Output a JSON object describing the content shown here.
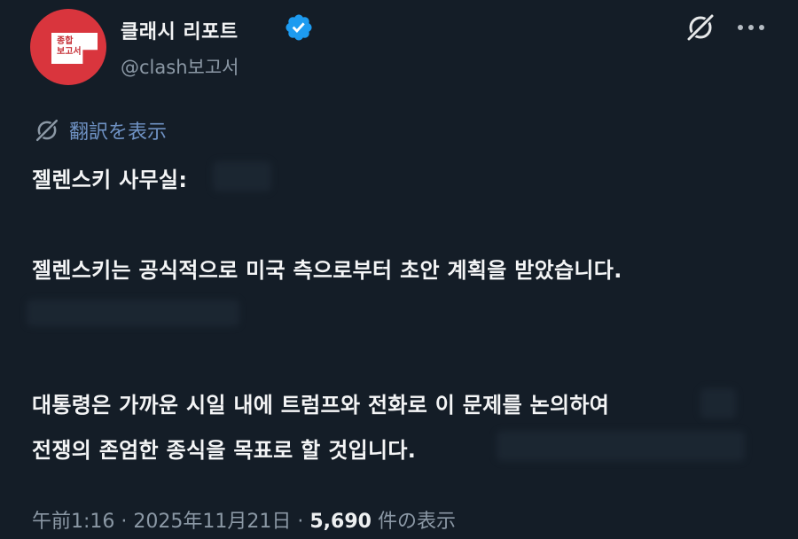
{
  "account": {
    "display_name": "클래시 리포트",
    "handle": "@clash보고서",
    "avatar_text": "종합\n보고서",
    "verified": true
  },
  "actions": {
    "grok_icon": "grok-icon",
    "more_icon": "more-dots-icon"
  },
  "translate": {
    "icon": "grok-icon",
    "label": "翻訳を表示"
  },
  "post": {
    "lines": [
      "젤렌스키 사무실:",
      "젤렌스키는 공식적으로 미국 측으로부터 초안 계획을 받았습니다.",
      "대통령은 가까운 시일 내에 트럼프와 전화로 이 문제를 논의하여",
      "전쟁의 존엄한 종식을 목표로 할 것입니다."
    ]
  },
  "meta": {
    "time": "午前1:16",
    "separator": " · ",
    "date": "2025年11月21日",
    "views_count": "5,690",
    "views_label": " 件の表示"
  },
  "colors": {
    "background": "#141d27",
    "accent_link": "#6f92c4",
    "verified_badge": "#1d9bf0",
    "avatar": "#d9353d"
  }
}
